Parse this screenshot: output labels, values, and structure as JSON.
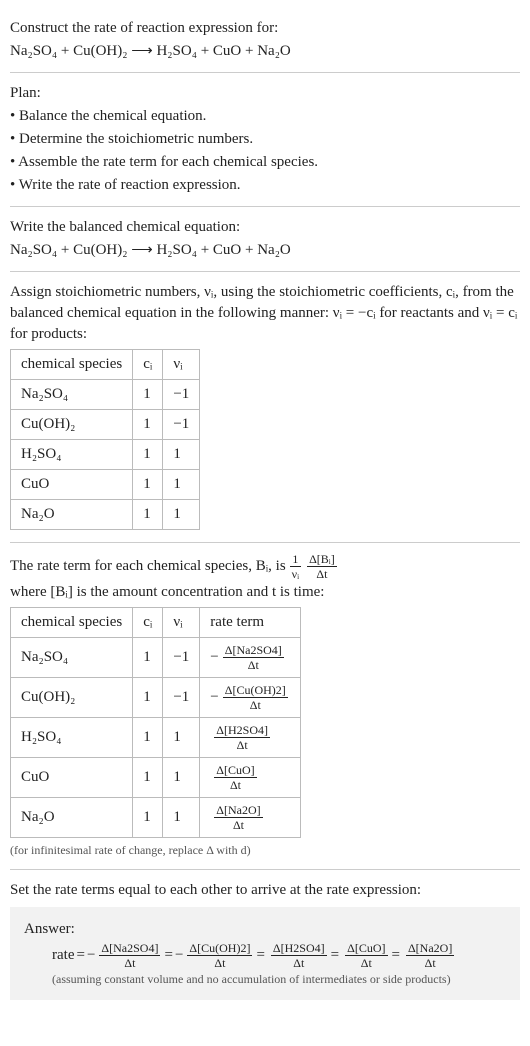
{
  "header": {
    "title": "Construct the rate of reaction expression for:",
    "equation": "Na₂SO₄ + Cu(OH)₂ ⟶ H₂SO₄ + CuO + Na₂O"
  },
  "plan": {
    "label": "Plan:",
    "items": [
      "• Balance the chemical equation.",
      "• Determine the stoichiometric numbers.",
      "• Assemble the rate term for each chemical species.",
      "• Write the rate of reaction expression."
    ]
  },
  "balanced": {
    "label": "Write the balanced chemical equation:",
    "equation": "Na₂SO₄ + Cu(OH)₂ ⟶ H₂SO₄ + CuO + Na₂O"
  },
  "stoich": {
    "intro1": "Assign stoichiometric numbers, νᵢ, using the stoichiometric coefficients, cᵢ, from the balanced chemical equation in the following manner: νᵢ = −cᵢ for reactants and νᵢ = cᵢ for products:",
    "headers": {
      "col1": "chemical species",
      "col2": "cᵢ",
      "col3": "νᵢ"
    },
    "rows": [
      {
        "species": "Na₂SO₄",
        "c": "1",
        "v": "−1"
      },
      {
        "species": "Cu(OH)₂",
        "c": "1",
        "v": "−1"
      },
      {
        "species": "H₂SO₄",
        "c": "1",
        "v": "1"
      },
      {
        "species": "CuO",
        "c": "1",
        "v": "1"
      },
      {
        "species": "Na₂O",
        "c": "1",
        "v": "1"
      }
    ]
  },
  "rateterm": {
    "intro_pre": "The rate term for each chemical species, Bᵢ, is ",
    "frac1_num": "1",
    "frac1_den": "νᵢ",
    "frac2_num": "Δ[Bᵢ]",
    "frac2_den": "Δt",
    "intro_post": " where [Bᵢ] is the amount concentration and t is time:",
    "headers": {
      "col1": "chemical species",
      "col2": "cᵢ",
      "col3": "νᵢ",
      "col4": "rate term"
    },
    "rows": [
      {
        "species": "Na₂SO₄",
        "c": "1",
        "v": "−1",
        "sign": "−",
        "num": "Δ[Na2SO4]",
        "den": "Δt"
      },
      {
        "species": "Cu(OH)₂",
        "c": "1",
        "v": "−1",
        "sign": "−",
        "num": "Δ[Cu(OH)2]",
        "den": "Δt"
      },
      {
        "species": "H₂SO₄",
        "c": "1",
        "v": "1",
        "sign": "",
        "num": "Δ[H2SO4]",
        "den": "Δt"
      },
      {
        "species": "CuO",
        "c": "1",
        "v": "1",
        "sign": "",
        "num": "Δ[CuO]",
        "den": "Δt"
      },
      {
        "species": "Na₂O",
        "c": "1",
        "v": "1",
        "sign": "",
        "num": "Δ[Na2O]",
        "den": "Δt"
      }
    ],
    "note": "(for infinitesimal rate of change, replace Δ with d)"
  },
  "final": {
    "label": "Set the rate terms equal to each other to arrive at the rate expression:",
    "answer_label": "Answer:",
    "rate_label": "rate",
    "terms": [
      {
        "sign": "−",
        "num": "Δ[Na2SO4]",
        "den": "Δt"
      },
      {
        "sign": "−",
        "num": "Δ[Cu(OH)2]",
        "den": "Δt"
      },
      {
        "sign": "",
        "num": "Δ[H2SO4]",
        "den": "Δt"
      },
      {
        "sign": "",
        "num": "Δ[CuO]",
        "den": "Δt"
      },
      {
        "sign": "",
        "num": "Δ[Na2O]",
        "den": "Δt"
      }
    ],
    "note": "(assuming constant volume and no accumulation of intermediates or side products)"
  }
}
